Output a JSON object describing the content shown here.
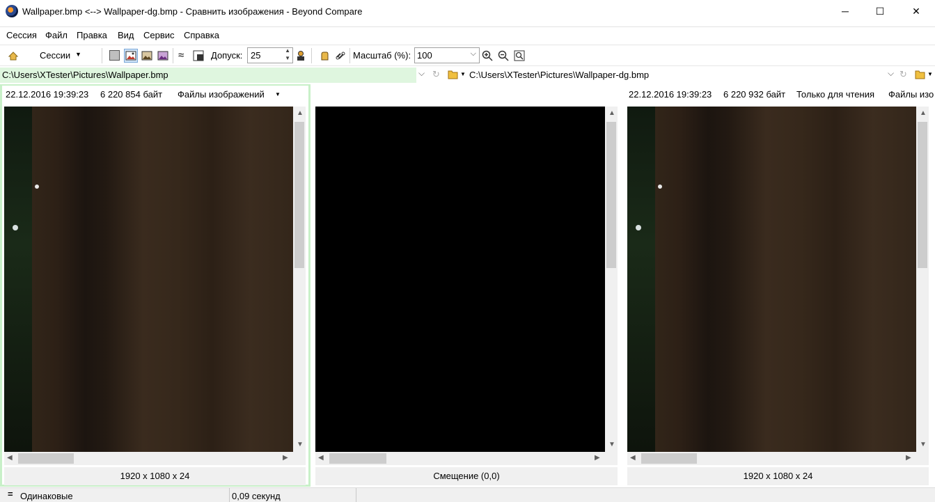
{
  "window": {
    "title": "Wallpaper.bmp <--> Wallpaper-dg.bmp - Сравнить изображения - Beyond Compare",
    "minimize": "─",
    "maximize": "☐",
    "close": "✕"
  },
  "menu": [
    "Сессия",
    "Файл",
    "Правка",
    "Вид",
    "Сервис",
    "Справка"
  ],
  "toolbar": {
    "sessions_label": "Сессии",
    "tolerance_label": "Допуск:",
    "tolerance_value": "25",
    "scale_label": "Масштаб (%):",
    "scale_value": "100",
    "approx_glyph": "≈"
  },
  "left": {
    "path": "C:\\Users\\XTester\\Pictures\\Wallpaper.bmp",
    "date": "22.12.2016 19:39:23",
    "size": "6 220 854 байт",
    "format": "Файлы изображений",
    "dimensions": "1920 x 1080 x 24"
  },
  "middle": {
    "offset": "Смещение (0,0)"
  },
  "right": {
    "path": "C:\\Users\\XTester\\Pictures\\Wallpaper-dg.bmp",
    "date": "22.12.2016 19:39:23",
    "size": "6 220 932 байт",
    "readonly": "Только для чтения",
    "format": "Файлы изо",
    "dimensions": "1920 x 1080 x 24"
  },
  "status": {
    "result": "Одинаковые",
    "time": "0,09 секунд"
  },
  "colors": {
    "left_path_bg": "#dff6df",
    "left_pane_border": "#c8f0c8",
    "diff_pane_bg": "#000000"
  }
}
